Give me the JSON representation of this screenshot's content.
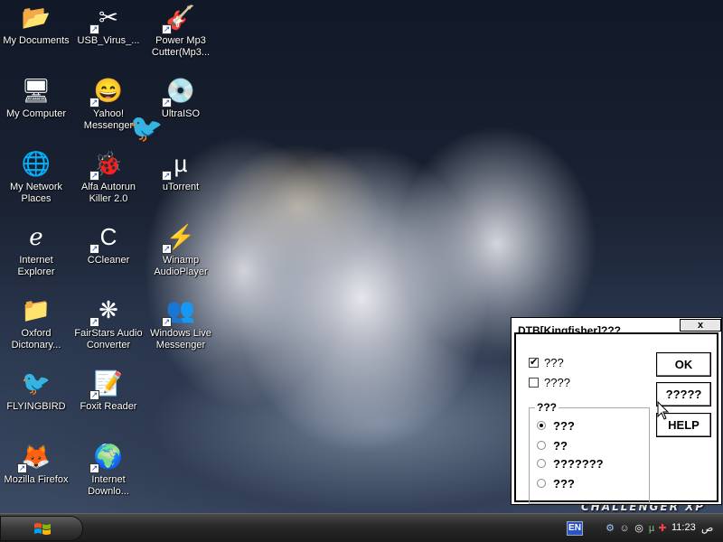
{
  "desktop": {
    "icons": [
      {
        "label": "My Documents",
        "icon": "folder-icon",
        "glyph": "📂",
        "shortcut": false
      },
      {
        "label": "USB_Virus_...",
        "icon": "usb-virus-icon",
        "glyph": "✂",
        "shortcut": true
      },
      {
        "label": "Power Mp3\nCutter(Mp3...",
        "icon": "power-mp3-cutter-icon",
        "glyph": "🎸",
        "shortcut": true
      },
      {
        "label": "My Computer",
        "icon": "computer-icon",
        "glyph": "🖥",
        "shortcut": false
      },
      {
        "label": "Yahoo!\nMessenger",
        "icon": "yahoo-messenger-icon",
        "glyph": "😄",
        "shortcut": true
      },
      {
        "label": "UltraISO",
        "icon": "ultraiso-icon",
        "glyph": "💿",
        "shortcut": true
      },
      {
        "label": "My Network\nPlaces",
        "icon": "network-places-icon",
        "glyph": "🌐",
        "shortcut": false
      },
      {
        "label": "Alfa Autorun\nKiller 2.0",
        "icon": "alfa-autorun-icon",
        "glyph": "🐞",
        "shortcut": true
      },
      {
        "label": "uTorrent",
        "icon": "utorrent-icon",
        "glyph": "µ",
        "shortcut": true
      },
      {
        "label": "Internet\nExplorer",
        "icon": "internet-explorer-icon",
        "glyph": "ℯ",
        "shortcut": false
      },
      {
        "label": "CCleaner",
        "icon": "ccleaner-icon",
        "glyph": "C",
        "shortcut": true
      },
      {
        "label": "Winamp\nAudioPlayer",
        "icon": "winamp-icon",
        "glyph": "⚡",
        "shortcut": true
      },
      {
        "label": "Oxford\nDictonary...",
        "icon": "folder-icon",
        "glyph": "📁",
        "shortcut": false
      },
      {
        "label": "FairStars Audio\nConverter",
        "icon": "fairstars-icon",
        "glyph": "❋",
        "shortcut": true
      },
      {
        "label": "Windows Live\nMessenger",
        "icon": "windows-live-messenger-icon",
        "glyph": "👥",
        "shortcut": true
      },
      {
        "label": "FLYINGBIRD",
        "icon": "bird-icon",
        "glyph": "🐦",
        "shortcut": false
      },
      {
        "label": "Foxit Reader",
        "icon": "foxit-reader-icon",
        "glyph": "📝",
        "shortcut": true
      },
      {
        "label": "Mozilla Firefox",
        "icon": "firefox-icon",
        "glyph": "🦊",
        "shortcut": true
      },
      {
        "label": "Internet\nDownlo...",
        "icon": "internet-download-manager-icon",
        "glyph": "🌍",
        "shortcut": true
      }
    ]
  },
  "dialog": {
    "title": "DTB[Kingfisher]???",
    "close_label": "x",
    "checkbox1": {
      "label": "???",
      "checked": true
    },
    "checkbox2": {
      "label": "????",
      "checked": false
    },
    "group_label": "???",
    "radios": [
      {
        "label": "???",
        "selected": true
      },
      {
        "label": "??",
        "selected": false
      },
      {
        "label": "???????",
        "selected": false
      },
      {
        "label": "???",
        "selected": false
      }
    ],
    "ok_label": "OK",
    "btn2_label": "?????",
    "help_label": "HELP"
  },
  "taskbar": {
    "language": "EN",
    "clock": "11:23",
    "clock_suffix": "ص",
    "brand": "CHALLENGER XP"
  },
  "colors": {
    "dialog_bg": "#ffffff",
    "taskbar": "#2a2a2a"
  }
}
